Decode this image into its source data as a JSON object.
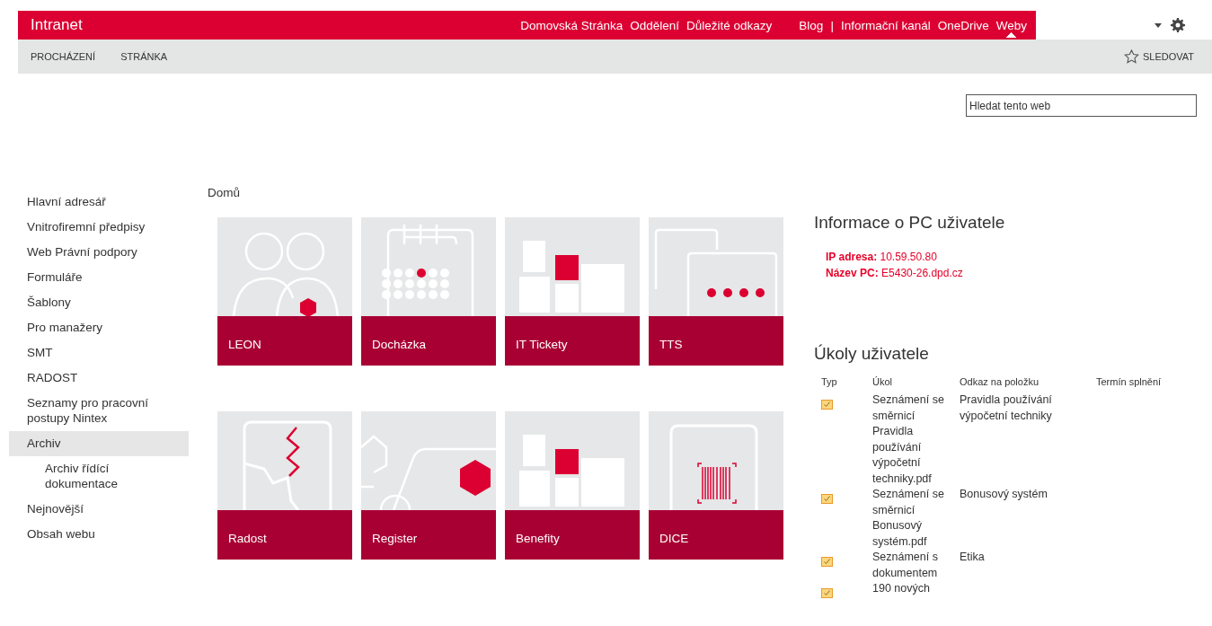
{
  "top_bar": {
    "title": "Intranet",
    "nav": [
      {
        "label": "Domovská Stránka",
        "kind": "link",
        "selected": false
      },
      {
        "label": "Oddělení",
        "kind": "link",
        "selected": false
      },
      {
        "label": "Důležité odkazy",
        "kind": "link",
        "selected": false
      },
      {
        "label": "Blog",
        "kind": "link",
        "selected": false
      },
      {
        "label": "|",
        "kind": "separator"
      },
      {
        "label": "Informační kanál",
        "kind": "link",
        "selected": false
      },
      {
        "label": "OneDrive",
        "kind": "link",
        "selected": false
      },
      {
        "label": "Weby",
        "kind": "link",
        "selected": true
      }
    ]
  },
  "ribbon": {
    "tabs": [
      {
        "label": "PROCHÁZENÍ"
      },
      {
        "label": "STRÁNKA"
      }
    ],
    "follow": "SLEDOVAT"
  },
  "search": {
    "placeholder": "Hledat tento web"
  },
  "sidebar": {
    "items": [
      {
        "label": "Hlavní adresář",
        "selected": false
      },
      {
        "label": "Vnitrofiremní předpisy",
        "selected": false
      },
      {
        "label": "Web Právní podpory",
        "selected": false
      },
      {
        "label": "Formuláře",
        "selected": false
      },
      {
        "label": "Šablony",
        "selected": false
      },
      {
        "label": "Pro manažery",
        "selected": false
      },
      {
        "label": "SMT",
        "selected": false
      },
      {
        "label": "RADOST",
        "selected": false
      },
      {
        "label": "Seznamy pro pracovní postupy Nintex",
        "selected": false
      },
      {
        "label": "Archiv",
        "selected": true,
        "children": [
          {
            "label": "Archiv řídící dokumentace",
            "selected": false
          }
        ]
      },
      {
        "label": "Nejnovější",
        "selected": false
      },
      {
        "label": "Obsah webu",
        "selected": false
      }
    ]
  },
  "breadcrumb": "Domů",
  "tiles": [
    {
      "label": "LEON",
      "kind": "people"
    },
    {
      "label": "Docházka",
      "kind": "calendar"
    },
    {
      "label": "IT Tickety",
      "kind": "blocks"
    },
    {
      "label": "TTS",
      "kind": "chat"
    },
    {
      "label": "Radost",
      "kind": "map"
    },
    {
      "label": "Register",
      "kind": "van"
    },
    {
      "label": "Benefity",
      "kind": "blocks"
    },
    {
      "label": "DICE",
      "kind": "scanner"
    }
  ],
  "pc_info": {
    "heading": "Informace o PC uživatele",
    "lines": [
      {
        "label": "IP adresa:",
        "value": "10.59.50.80"
      },
      {
        "label": "Název PC:",
        "value": "E5430-26.dpd.cz"
      }
    ]
  },
  "tasks": {
    "heading": "Úkoly uživatele",
    "columns": [
      "Typ",
      "Úkol",
      "Odkaz na položku",
      "Termín splnění"
    ],
    "rows": [
      {
        "task": "Seznámení se směrnicí Pravidla používání výpočetní techniky.pdf",
        "link": "Pravidla používání výpočetní techniky"
      },
      {
        "task": "Seznámení se směrnicí Bonusový systém.pdf",
        "link": "Bonusový systém"
      },
      {
        "task": "Seznámení s dokumentem",
        "link": "Etika"
      },
      {
        "task": "190 nových"
      }
    ]
  }
}
